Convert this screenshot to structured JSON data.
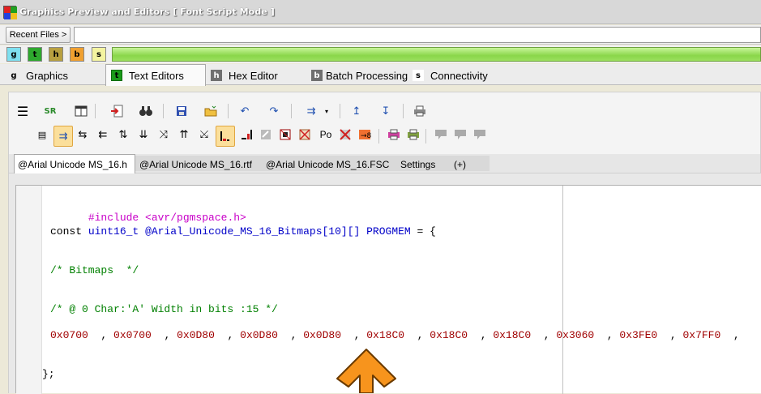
{
  "window": {
    "title": "Graphics Preview and Editors [ Font Script Mode ]"
  },
  "recent": {
    "button_label": "Recent Files >",
    "input_value": ""
  },
  "quick_buttons": [
    {
      "label": "g",
      "color": "#7fe0f0"
    },
    {
      "label": "t",
      "color": "#2ea82e"
    },
    {
      "label": "h",
      "color": "#b8a040"
    },
    {
      "label": "b",
      "color": "#f0a030"
    },
    {
      "label": "s",
      "color": "#f4f4a0"
    }
  ],
  "main_tabs": [
    {
      "tag": "g",
      "label": "Graphics",
      "tag_color": "#ececec"
    },
    {
      "tag": "t",
      "label": "Text Editors",
      "tag_color": "#1a9a1a"
    },
    {
      "tag": "h",
      "label": "Hex Editor",
      "tag_color": "#707070"
    },
    {
      "tag": "b",
      "label": "Batch Processing",
      "tag_color": "#707070"
    },
    {
      "tag": "s",
      "label": "Connectivity",
      "tag_color": "#ffffff"
    }
  ],
  "toolbar_glyphs": {
    "menu": "☰",
    "sr": "SR",
    "po": "Po"
  },
  "file_tabs": [
    {
      "label": "@Arial Unicode MS_16.h"
    },
    {
      "label": "@Arial Unicode MS_16.rtf"
    },
    {
      "label": "@Arial Unicode MS_16.FSC"
    },
    {
      "label": "Settings"
    },
    {
      "label": "(+)"
    }
  ],
  "code": {
    "line1_pre": "#include <avr/pgmspace.h>",
    "line2_kw": "const",
    "line2_type": "uint16_t",
    "line2_name": "@Arial_Unicode_MS_16_Bitmaps[10][]",
    "line2_progmem": "PROGMEM",
    "line2_rest": "= {",
    "line3_comment": "/* Bitmaps  */",
    "line4_comment": "/* @ 0 Char:'A' Width in bits :15 */",
    "hex_values": [
      "0x0700",
      "0x0700",
      "0x0D80",
      "0x0D80",
      "0x0D80",
      "0x18C0",
      "0x18C0",
      "0x18C0",
      "0x3060",
      "0x3FE0",
      "0x7FF0"
    ],
    "hex_separator": ",",
    "closing": "};"
  },
  "colors": {
    "accent_orange": "#f7941d",
    "progress_green": "#8ad64a"
  }
}
